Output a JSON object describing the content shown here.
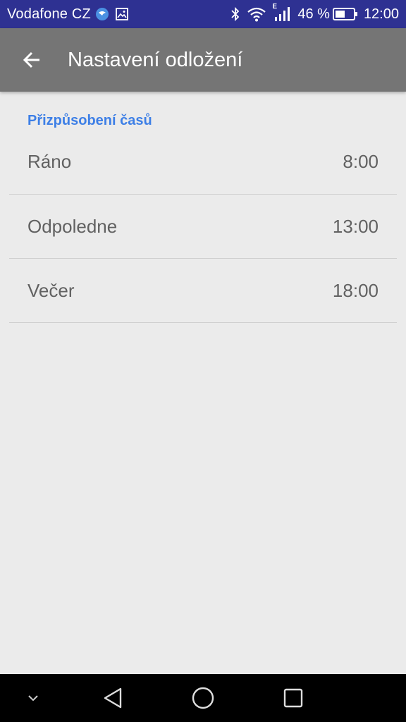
{
  "status_bar": {
    "carrier": "Vodafone CZ",
    "battery_percent": "46 %",
    "time": "12:00",
    "network_type": "E",
    "icons": [
      "messenger-bubble-icon",
      "image-notification-icon",
      "bluetooth-icon",
      "wifi-icon",
      "signal-icon",
      "battery-icon"
    ],
    "background_color": "#2e3192"
  },
  "app_bar": {
    "title": "Nastavení odložení",
    "back_icon": "arrow-back-icon",
    "background_color": "#757575"
  },
  "section": {
    "header": "Přizpůsobení časů",
    "accent_color": "#3d7fe6",
    "items": [
      {
        "label": "Ráno",
        "value": "8:00"
      },
      {
        "label": "Odpoledne",
        "value": "13:00"
      },
      {
        "label": "Večer",
        "value": "18:00"
      }
    ]
  },
  "nav_bar": {
    "buttons": [
      "chevron-down-icon",
      "back-triangle-icon",
      "home-circle-icon",
      "recents-square-icon"
    ]
  }
}
